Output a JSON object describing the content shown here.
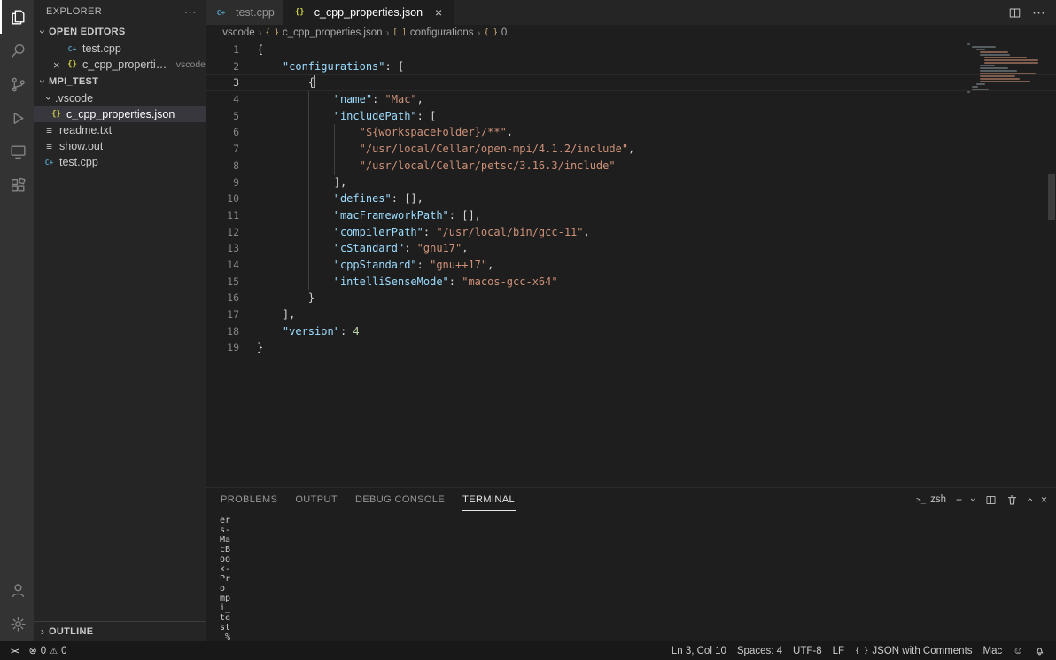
{
  "colors": {
    "editor_bg": "#1e1e1e",
    "sidebar_bg": "#252526",
    "activitybar_bg": "#333333",
    "selection_bg": "#37373d",
    "json_key": "#9cdcfe",
    "json_string": "#ce9178",
    "json_number": "#b5cea8",
    "json_icon": "#cbcb41",
    "cpp_icon": "#519aba"
  },
  "activity_bar": {
    "items": [
      {
        "name": "explorer",
        "active": true
      },
      {
        "name": "search",
        "active": false
      },
      {
        "name": "source-control",
        "active": false
      },
      {
        "name": "run-debug",
        "active": false
      },
      {
        "name": "remote-explorer",
        "active": false
      },
      {
        "name": "extensions",
        "active": false
      }
    ],
    "bottom_items": [
      {
        "name": "account",
        "active": false
      },
      {
        "name": "settings",
        "active": false
      }
    ]
  },
  "sidebar": {
    "title": "EXPLORER",
    "open_editors": {
      "label": "OPEN EDITORS",
      "items": [
        {
          "label": "test.cpp",
          "icon": "cpp",
          "closable": false,
          "detail": ""
        },
        {
          "label": "c_cpp_properties.json",
          "icon": "json",
          "closable": true,
          "detail": ".vscode"
        }
      ]
    },
    "tree": {
      "label": "MPI_TEST",
      "items": [
        {
          "label": ".vscode",
          "type": "folder",
          "expanded": true,
          "depth": 0,
          "selected": false
        },
        {
          "label": "c_cpp_properties.json",
          "type": "json",
          "depth": 1,
          "selected": true
        },
        {
          "label": "readme.txt",
          "type": "txt",
          "depth": 0,
          "selected": false
        },
        {
          "label": "show.out",
          "type": "txt",
          "depth": 0,
          "selected": false
        },
        {
          "label": "test.cpp",
          "type": "cpp",
          "depth": 0,
          "selected": false
        }
      ]
    },
    "outline": {
      "label": "OUTLINE",
      "collapsed": true
    }
  },
  "editor": {
    "tabs": [
      {
        "label": "test.cpp",
        "icon": "cpp",
        "active": false
      },
      {
        "label": "c_cpp_properties.json",
        "icon": "json",
        "active": true
      }
    ],
    "breadcrumbs": [
      {
        "label": ".vscode",
        "icon": ""
      },
      {
        "label": "c_cpp_properties.json",
        "icon": "braces"
      },
      {
        "label": "configurations",
        "icon": "brackets"
      },
      {
        "label": "0",
        "icon": "braces"
      }
    ],
    "cursor": {
      "line": 3,
      "col": 10
    },
    "lines": [
      {
        "n": 1,
        "indent": 0,
        "tokens": [
          [
            "{",
            "p"
          ]
        ]
      },
      {
        "n": 2,
        "indent": 4,
        "tokens": [
          [
            "\"configurations\"",
            "k"
          ],
          [
            ": ",
            "p"
          ],
          [
            "[",
            "p"
          ]
        ]
      },
      {
        "n": 3,
        "indent": 8,
        "tokens": [
          [
            "{",
            "p"
          ]
        ]
      },
      {
        "n": 4,
        "indent": 12,
        "tokens": [
          [
            "\"name\"",
            "k"
          ],
          [
            ": ",
            "p"
          ],
          [
            "\"Mac\"",
            "s"
          ],
          [
            ",",
            "p"
          ]
        ]
      },
      {
        "n": 5,
        "indent": 12,
        "tokens": [
          [
            "\"includePath\"",
            "k"
          ],
          [
            ": ",
            "p"
          ],
          [
            "[",
            "p"
          ]
        ]
      },
      {
        "n": 6,
        "indent": 16,
        "tokens": [
          [
            "\"${workspaceFolder}/**\"",
            "s"
          ],
          [
            ",",
            "p"
          ]
        ]
      },
      {
        "n": 7,
        "indent": 16,
        "tokens": [
          [
            "\"/usr/local/Cellar/open-mpi/4.1.2/include\"",
            "s"
          ],
          [
            ",",
            "p"
          ]
        ]
      },
      {
        "n": 8,
        "indent": 16,
        "tokens": [
          [
            "\"/usr/local/Cellar/petsc/3.16.3/include\"",
            "s"
          ]
        ]
      },
      {
        "n": 9,
        "indent": 12,
        "tokens": [
          [
            "],",
            "p"
          ]
        ]
      },
      {
        "n": 10,
        "indent": 12,
        "tokens": [
          [
            "\"defines\"",
            "k"
          ],
          [
            ": ",
            "p"
          ],
          [
            "[],",
            "p"
          ]
        ]
      },
      {
        "n": 11,
        "indent": 12,
        "tokens": [
          [
            "\"macFrameworkPath\"",
            "k"
          ],
          [
            ": ",
            "p"
          ],
          [
            "[],",
            "p"
          ]
        ]
      },
      {
        "n": 12,
        "indent": 12,
        "tokens": [
          [
            "\"compilerPath\"",
            "k"
          ],
          [
            ": ",
            "p"
          ],
          [
            "\"/usr/local/bin/gcc-11\"",
            "s"
          ],
          [
            ",",
            "p"
          ]
        ]
      },
      {
        "n": 13,
        "indent": 12,
        "tokens": [
          [
            "\"cStandard\"",
            "k"
          ],
          [
            ": ",
            "p"
          ],
          [
            "\"gnu17\"",
            "s"
          ],
          [
            ",",
            "p"
          ]
        ]
      },
      {
        "n": 14,
        "indent": 12,
        "tokens": [
          [
            "\"cppStandard\"",
            "k"
          ],
          [
            ": ",
            "p"
          ],
          [
            "\"gnu++17\"",
            "s"
          ],
          [
            ",",
            "p"
          ]
        ]
      },
      {
        "n": 15,
        "indent": 12,
        "tokens": [
          [
            "\"intelliSenseMode\"",
            "k"
          ],
          [
            ": ",
            "p"
          ],
          [
            "\"macos-gcc-x64\"",
            "s"
          ]
        ]
      },
      {
        "n": 16,
        "indent": 8,
        "tokens": [
          [
            "}",
            "p"
          ]
        ]
      },
      {
        "n": 17,
        "indent": 4,
        "tokens": [
          [
            "],",
            "p"
          ]
        ]
      },
      {
        "n": 18,
        "indent": 4,
        "tokens": [
          [
            "\"version\"",
            "k"
          ],
          [
            ": ",
            "p"
          ],
          [
            "4",
            "n"
          ]
        ]
      },
      {
        "n": 19,
        "indent": 0,
        "tokens": [
          [
            "}",
            "p"
          ]
        ]
      }
    ]
  },
  "panel": {
    "tabs": [
      {
        "label": "PROBLEMS",
        "active": false
      },
      {
        "label": "OUTPUT",
        "active": false
      },
      {
        "label": "DEBUG CONSOLE",
        "active": false
      },
      {
        "label": "TERMINAL",
        "active": true
      }
    ],
    "shell": "zsh",
    "terminal_lines": [
      "er",
      "s-",
      "Ma",
      "cB",
      "oo",
      "k-",
      "Pr",
      "o ",
      "mp",
      "i_",
      "te",
      "st",
      " %"
    ]
  },
  "status_bar": {
    "errors": "0",
    "warnings": "0",
    "items_right": [
      {
        "label": "Ln 3, Col 10",
        "icon": ""
      },
      {
        "label": "Spaces: 4",
        "icon": ""
      },
      {
        "label": "UTF-8",
        "icon": ""
      },
      {
        "label": "LF",
        "icon": ""
      },
      {
        "label": "JSON with Comments",
        "icon": "braces"
      },
      {
        "label": "Mac",
        "icon": ""
      }
    ]
  }
}
